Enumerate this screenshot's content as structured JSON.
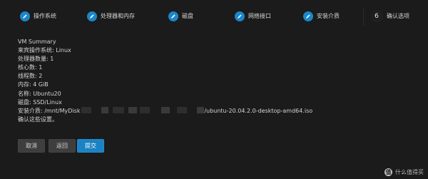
{
  "steps": [
    {
      "label": "操作系统",
      "icon": "pencil-icon",
      "state": "done"
    },
    {
      "label": "处理器和内存",
      "icon": "pencil-icon",
      "state": "done"
    },
    {
      "label": "磁盘",
      "icon": "pencil-icon",
      "state": "done"
    },
    {
      "label": "网络接口",
      "icon": "pencil-icon",
      "state": "done"
    },
    {
      "label": "安装介质",
      "icon": "pencil-icon",
      "state": "done"
    },
    {
      "label": "确认选项",
      "number": "6",
      "state": "active"
    }
  ],
  "summary": {
    "title": "VM Summary",
    "guest_os": "来宾操作系统: Linux",
    "processors": "处理器数量: 1",
    "cores": "核心数: 1",
    "threads": "线程数: 2",
    "memory": "内存: 4 GiB",
    "name": "名称: Ubuntu20",
    "disk": "磁盘: SSD/Linux",
    "media_prefix": "安装介质: /mnt/MyDisk",
    "media_suffix": "/ubuntu-20.04.2.0-desktop-amd64.iso",
    "confirm": "确认这些设置。"
  },
  "buttons": {
    "cancel": "取消",
    "back": "返回",
    "submit": "提交"
  },
  "watermark": {
    "badge": "值",
    "text": "什么值得买"
  },
  "colors": {
    "accent": "#1c86c9",
    "background": "#1b1b1b",
    "text": "#d4d4d4"
  }
}
